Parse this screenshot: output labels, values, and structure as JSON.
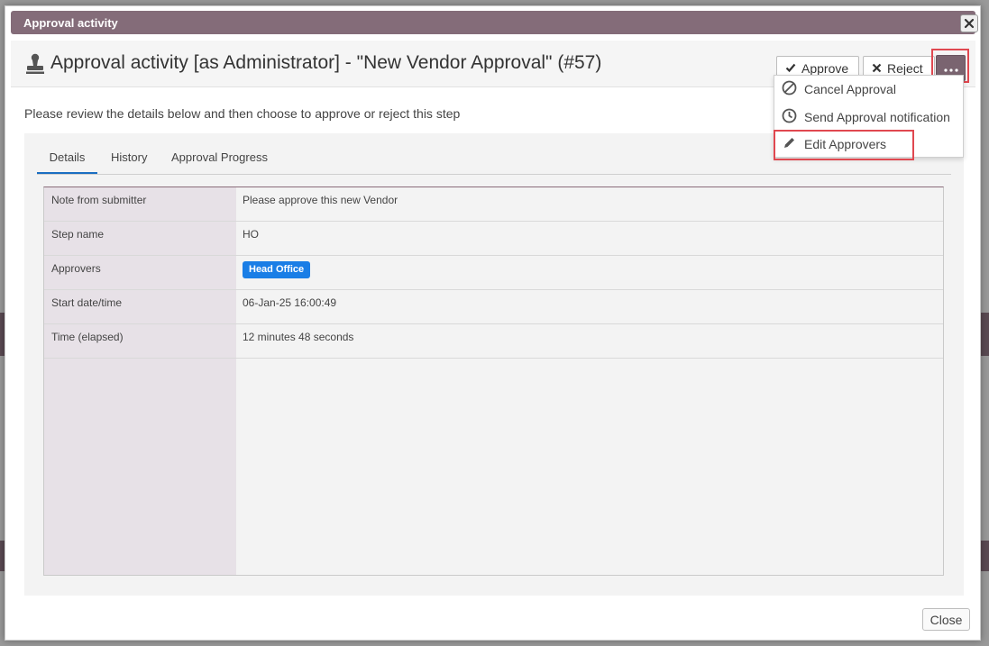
{
  "window": {
    "title": "Approval activity"
  },
  "header": {
    "title": "Approval activity [as Administrator] - \"New Vendor Approval\" (#57)",
    "approve_label": "Approve",
    "reject_label": "Reject"
  },
  "menu": {
    "items": [
      {
        "label": "Cancel Approval",
        "icon": "cancel-icon"
      },
      {
        "label": "Send Approval notification",
        "icon": "clock-icon"
      },
      {
        "label": "Edit Approvers",
        "icon": "pencil-icon"
      }
    ]
  },
  "instructions": "Please review the details below and then choose to approve or reject this step",
  "tabs": [
    {
      "label": "Details",
      "active": true
    },
    {
      "label": "History",
      "active": false
    },
    {
      "label": "Approval Progress",
      "active": false
    }
  ],
  "details": {
    "note_label": "Note from submitter",
    "note_value": "Please approve this new Vendor",
    "step_label": "Step name",
    "step_value": "HO",
    "approvers_label": "Approvers",
    "approvers_badge": "Head Office",
    "start_label": "Start date/time",
    "start_value": "06-Jan-25 16:00:49",
    "elapsed_label": "Time (elapsed)",
    "elapsed_value": "12 minutes 48 seconds"
  },
  "footer": {
    "close_label": "Close"
  },
  "colors": {
    "titlebar": "#846c79",
    "more_button": "#7a6470",
    "highlight": "#e04850",
    "badge": "#1a7ee6",
    "active_tab": "#1b6ec2"
  }
}
